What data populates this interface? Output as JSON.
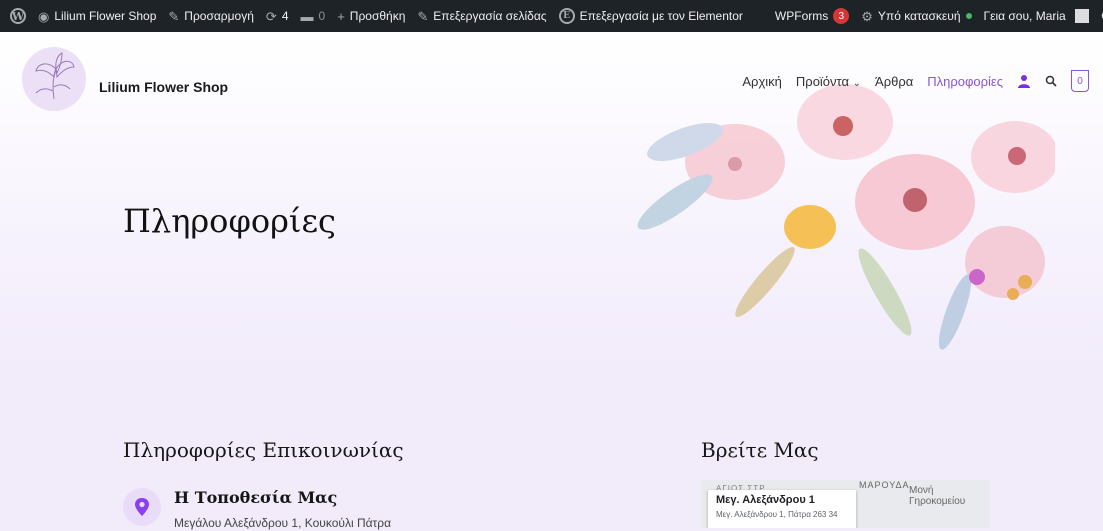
{
  "adminbar": {
    "site_name": "Lilium Flower Shop",
    "customize": "Προσαρμογή",
    "updates_count": "4",
    "comments_count": "0",
    "new": "Προσθήκη",
    "edit_page": "Επεξεργασία σελίδας",
    "edit_elementor": "Επεξεργασία με τον Elementor",
    "wpforms": "WPForms",
    "wpforms_badge": "3",
    "maintenance": "Υπό κατασκευή",
    "greeting": "Γεια σου, Maria"
  },
  "header": {
    "site_title": "Lilium Flower Shop",
    "nav": {
      "home": "Αρχική",
      "products": "Προϊόντα",
      "articles": "Άρθρα",
      "info": "Πληροφορίες"
    },
    "cart_count": "0"
  },
  "hero": {
    "title": "Πληροφορίες"
  },
  "contact": {
    "heading": "Πληροφορίες Επικοινωνίας",
    "location_title": "Η Τοποθεσία Μας",
    "location_address": "Μεγάλου Αλεξάνδρου 1, Κουκούλι Πάτρα"
  },
  "map_section": {
    "heading": "Βρείτε Μας",
    "card_title": "Μεγ. Αλεξάνδρου 1",
    "card_address": "Μεγ. Αλεξάνδρου 1, Πάτρα 263 34",
    "label_area1": "ΜΑΡΟΥΔΑ",
    "label_area2": "Μονή Γηροκομείου",
    "label_area3": "ΑΓΙΟΣ ΣΤΡ."
  },
  "colors": {
    "accent": "#8a55d8",
    "adminbar": "#1d2327"
  },
  "icons": [
    "wordpress-icon",
    "dashboard-icon",
    "brush-icon",
    "refresh-icon",
    "comment-icon",
    "plus-icon",
    "pencil-icon",
    "elementor-icon",
    "gear-icon",
    "user-icon",
    "search-icon",
    "cart-icon",
    "pin-icon"
  ]
}
